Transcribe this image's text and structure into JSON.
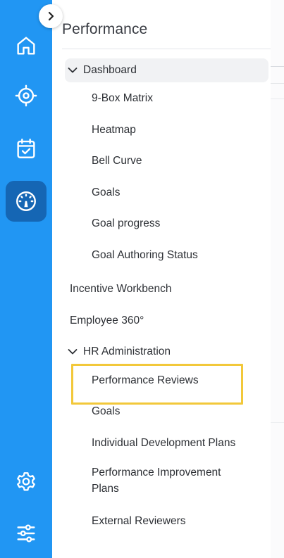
{
  "panel": {
    "title": "Performance"
  },
  "rail": {
    "items": [
      {
        "name": "home-icon"
      },
      {
        "name": "target-icon"
      },
      {
        "name": "calendar-check-icon"
      },
      {
        "name": "gauge-icon",
        "active": true
      },
      {
        "name": "gear-icon"
      },
      {
        "name": "sliders-icon"
      }
    ]
  },
  "nav": {
    "dashboard": {
      "label": "Dashboard",
      "children": [
        "9-Box Matrix",
        "Heatmap",
        "Bell Curve",
        "Goals",
        "Goal progress",
        "Goal Authoring Status"
      ]
    },
    "incentive_workbench": "Incentive Workbench",
    "employee_360": "Employee 360°",
    "hr_administration": {
      "label": "HR Administration",
      "children": [
        "Performance Reviews",
        "Goals",
        "Individual Development Plans",
        "Performance Improvement Plans",
        "External Reviewers"
      ]
    }
  },
  "colors": {
    "rail": "#2196f3",
    "rail_active": "#1566b4",
    "highlight": "#f2c83a"
  }
}
